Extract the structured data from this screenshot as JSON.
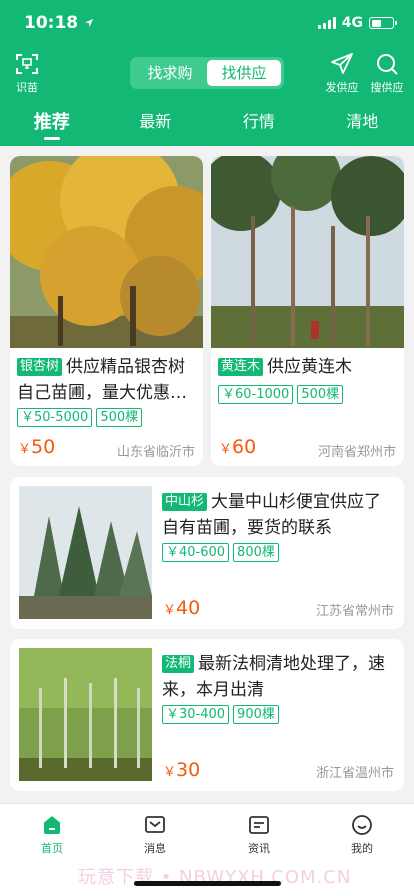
{
  "status_bar": {
    "time": "10:18",
    "network": "4G"
  },
  "header": {
    "scan_label": "识苗",
    "segment": [
      "找求购",
      "找供应"
    ],
    "post_label": "发供应",
    "search_label": "搜供应",
    "tabs": [
      "推荐",
      "最新",
      "行情",
      "清地"
    ]
  },
  "listings": [
    {
      "tag": "银杏树",
      "title": "供应精品银杏树自己苗圃，量大优惠…",
      "price_range": "￥50-5000",
      "quantity": "500棵",
      "currency": "￥",
      "price": "50",
      "location": "山东省临沂市"
    },
    {
      "tag": "黄连木",
      "title": "供应黄连木",
      "price_range": "￥60-1000",
      "quantity": "500棵",
      "currency": "￥",
      "price": "60",
      "location": "河南省郑州市"
    },
    {
      "tag": "中山杉",
      "title": "大量中山杉便宜供应了自有苗圃，要货的联系",
      "price_range": "￥40-600",
      "quantity": "800棵",
      "currency": "￥",
      "price": "40",
      "location": "江苏省常州市"
    },
    {
      "tag": "法桐",
      "title": "最新法桐清地处理了，速来，本月出清",
      "price_range": "￥30-400",
      "quantity": "900棵",
      "currency": "￥",
      "price": "30",
      "location": "浙江省温州市"
    }
  ],
  "tabbar": [
    "首页",
    "消息",
    "资讯",
    "我的"
  ],
  "watermark": "玩意下载 • NBWYXH.COM.CN",
  "colors": {
    "brand": "#12b873",
    "price": "#f35b0a"
  }
}
